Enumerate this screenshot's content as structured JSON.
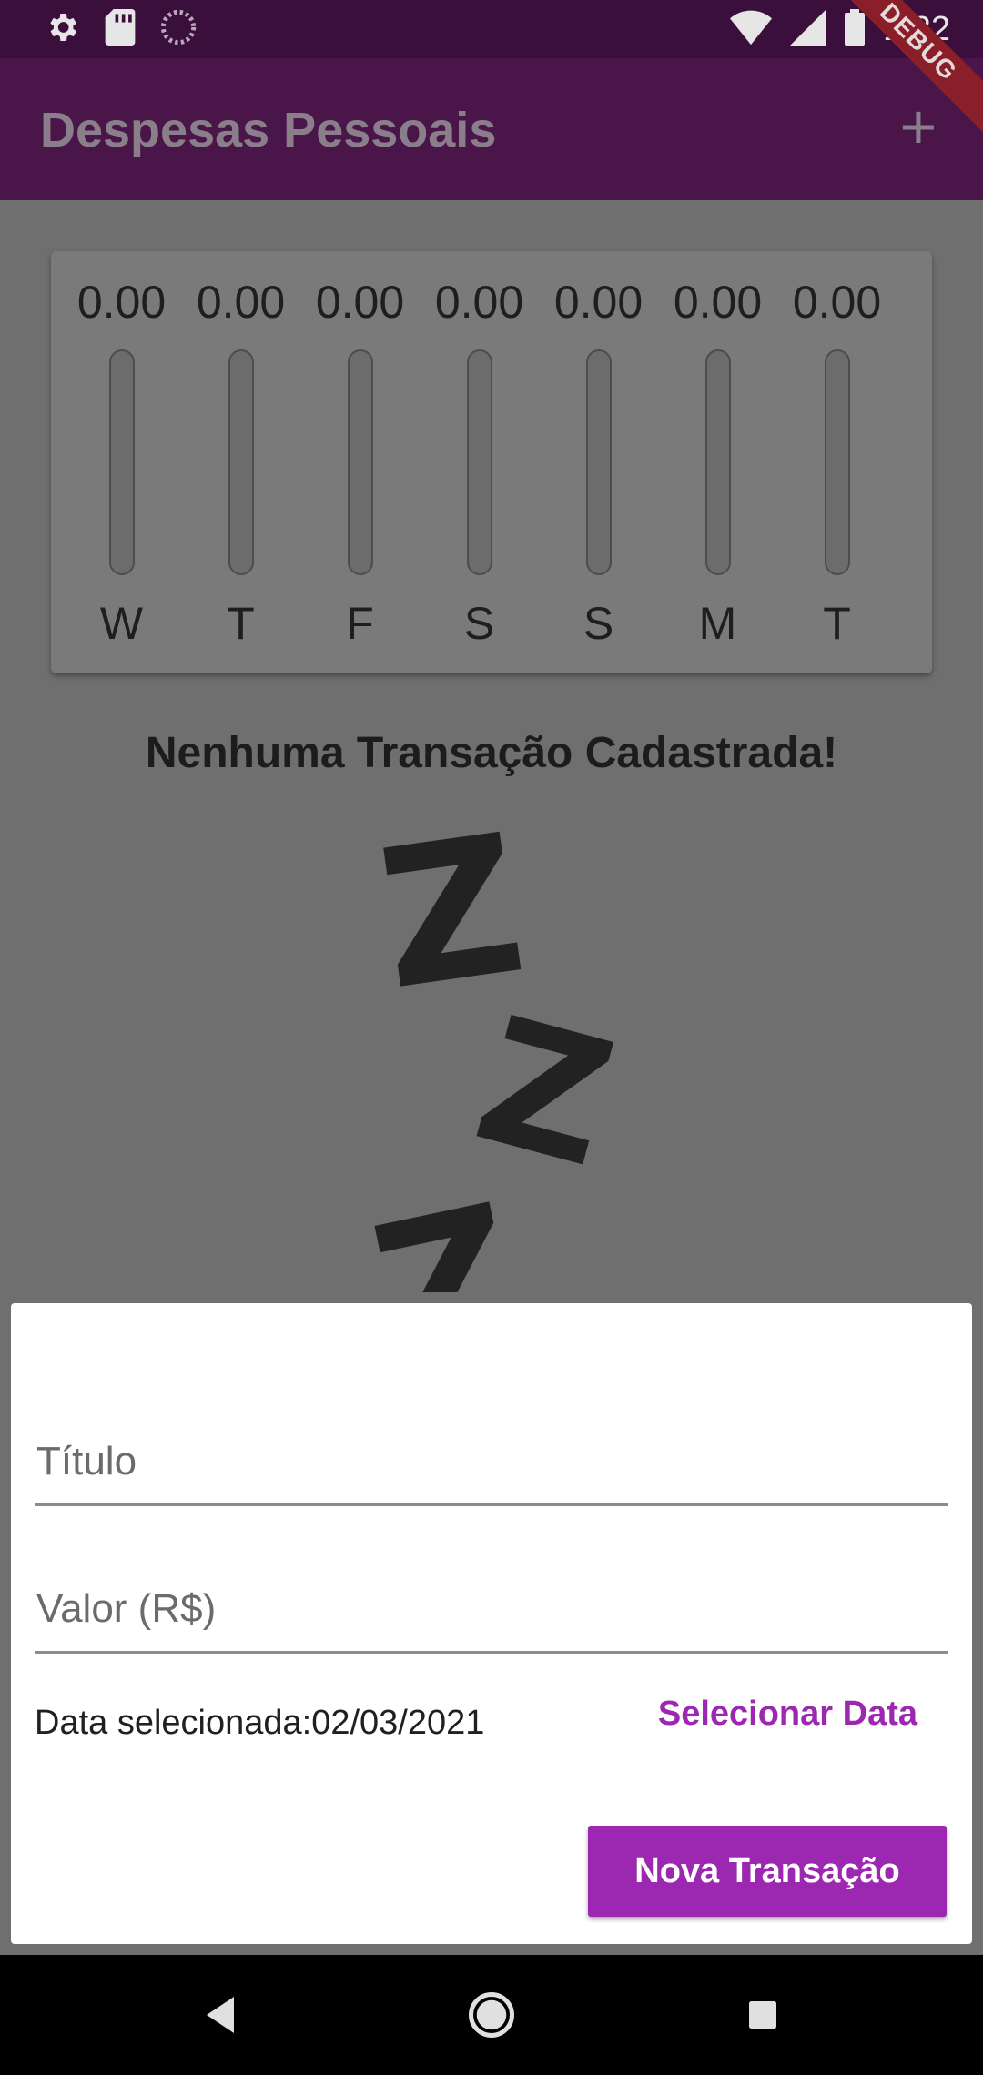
{
  "status_bar": {
    "time": "1:22",
    "icons": [
      "settings-icon",
      "sd-card-icon",
      "loading-icon",
      "wifi-icon",
      "signal-icon",
      "battery-icon"
    ]
  },
  "app_bar": {
    "title": "Despesas Pessoais",
    "add_label": "+",
    "debug_label": "DEBUG"
  },
  "chart_data": {
    "type": "bar",
    "categories": [
      "W",
      "T",
      "F",
      "S",
      "S",
      "M",
      "T"
    ],
    "value_labels": [
      "0.00",
      "0.00",
      "0.00",
      "0.00",
      "0.00",
      "0.00",
      "0.00"
    ],
    "values": [
      0,
      0,
      0,
      0,
      0,
      0,
      0
    ],
    "title": "",
    "xlabel": "",
    "ylabel": ""
  },
  "empty_state": {
    "message": "Nenhuma Transação Cadastrada!",
    "z1": "Z",
    "z2": "Z",
    "z3": "Z"
  },
  "form": {
    "title_placeholder": "Título",
    "title_value": "",
    "value_placeholder": "Valor (R$)",
    "value_value": "",
    "date_text": "Data selecionada:02/03/2021",
    "select_date_label": "Selecionar Data",
    "submit_label": "Nova Transação"
  },
  "colors": {
    "primary": "#9c27b0",
    "app_bar_dimmed": "#4a164a"
  }
}
